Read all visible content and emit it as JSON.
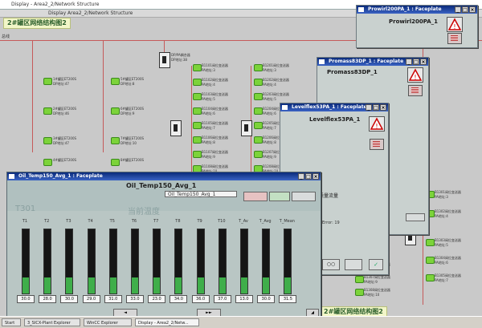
{
  "main_window": {
    "title": "Display - Area2_2/Network Structure",
    "menu": "Display Area2_2/Network Structure",
    "page_banner": "2#罐区网络结构图2",
    "left_label": "总线"
  },
  "network": {
    "left_column": [
      {
        "name": "1#罐区ET200S",
        "sub": "DP地址:47"
      },
      {
        "name": "2#罐区ET200S",
        "sub": "DP地址:46"
      },
      {
        "name": "3#罐区ET200S",
        "sub": "DP地址:47"
      },
      {
        "name": "4#罐区ET200S",
        "sub": "DP地址:49"
      }
    ],
    "mid_column": [
      {
        "name": "5#罐区ET200S",
        "sub": "DP地址:8"
      },
      {
        "name": "6#罐区ET200S",
        "sub": "DP地址:9"
      },
      {
        "name": "7#罐区ET200S",
        "sub": "DP地址:10"
      },
      {
        "name": "8#罐区ET200S",
        "sub": "DP地址:11"
      }
    ],
    "link_label": "DP/PA耦合器",
    "link_sub": "DP地址:38",
    "col3": [
      {
        "name": "B1101阀位变送器",
        "sub": "PA地址:3"
      },
      {
        "name": "B1102阀位变送器",
        "sub": "PA地址:4"
      },
      {
        "name": "B1103阀位变送器",
        "sub": "PA地址:5"
      },
      {
        "name": "B1104阀位变送器",
        "sub": "PA地址:6"
      },
      {
        "name": "B1105阀位变送器",
        "sub": "PA地址:7"
      },
      {
        "name": "B1106阀位变送器",
        "sub": "PA地址:8"
      },
      {
        "name": "B1107阀位变送器",
        "sub": "PA地址:9"
      },
      {
        "name": "B1108阀位变送器",
        "sub": "PA地址:10"
      }
    ],
    "col4": [
      {
        "name": "B1201阀位变送器",
        "sub": "PA地址:3"
      },
      {
        "name": "B1202阀位变送器",
        "sub": "PA地址:4"
      },
      {
        "name": "B1203阀位变送器",
        "sub": "PA地址:5"
      },
      {
        "name": "B1204阀位变送器",
        "sub": "PA地址:6"
      },
      {
        "name": "B1205阀位变送器",
        "sub": "PA地址:7"
      },
      {
        "name": "B1206阀位变送器",
        "sub": "PA地址:8"
      },
      {
        "name": "B1207阀位变送器",
        "sub": "PA地址:9"
      },
      {
        "name": "B1208阀位变送器",
        "sub": "PA地址:10"
      }
    ],
    "right_column": [
      {
        "name": "B1301阀位变送器",
        "sub": "PA地址:3"
      },
      {
        "name": "B1302阀位变送器",
        "sub": "PA地址:4"
      },
      {
        "name": "B1303阀位变送器",
        "sub": "PA地址:5"
      },
      {
        "name": "B1304阀位变送器",
        "sub": "PA地址:6"
      },
      {
        "name": "B1305阀位变送器",
        "sub": "PA地址:7"
      }
    ],
    "bottom_banner": "2#罐区网络结构图2",
    "bottom_nodes": [
      {
        "name": "B1306阀位变送器",
        "sub": "PA地址:8"
      },
      {
        "name": "B1307阀位变送器",
        "sub": "PA地址:9"
      },
      {
        "name": "B1308阀位变送器",
        "sub": "PA地址:10"
      }
    ]
  },
  "faceplates": {
    "prowirl": {
      "title": "Prowirl200PA_1 : Faceplate",
      "name": "Prowirl200PA_1"
    },
    "promass": {
      "title": "Promass83DP_1 : Faceplate",
      "name": "Promass83DP_1"
    },
    "levelflex": {
      "title": "Levelflex53PA_1 : Faceplate",
      "name": "Levelflex53PA_1",
      "partial_text": "质量流量",
      "partial_text2": "Error: 19",
      "partial_text3": "质量流量"
    }
  },
  "oil": {
    "title": "Oil_Temp150_Avg_1 : Faceplate",
    "name": "Oil_Temp150_Avg_1",
    "field": "Oil_Temp150_Avg_1",
    "tag": "T301",
    "heading": "当前温度",
    "channels": [
      {
        "label": "T1",
        "value": "30.0",
        "level": 0.25
      },
      {
        "label": "T2",
        "value": "28.0",
        "level": 0.25
      },
      {
        "label": "T3",
        "value": "30.0",
        "level": 0.25
      },
      {
        "label": "T4",
        "value": "29.0",
        "level": 0.25
      },
      {
        "label": "T5",
        "value": "31.0",
        "level": 0.25
      },
      {
        "label": "T6",
        "value": "33.0",
        "level": 0.25
      },
      {
        "label": "T7",
        "value": "23.0",
        "level": 0.25
      },
      {
        "label": "T8",
        "value": "34.0",
        "level": 0.25
      },
      {
        "label": "T9",
        "value": "36.0",
        "level": 0.25
      },
      {
        "label": "T10",
        "value": "37.0",
        "level": 0.25
      },
      {
        "label": "T_Av",
        "value": "13.0",
        "level": 0.25
      },
      {
        "label": "T_Avg",
        "value": "30.0",
        "level": 0.25
      },
      {
        "label": "T_Mean",
        "value": "31.5",
        "level": 0.25
      }
    ]
  },
  "taskbar": {
    "items": [
      "Start",
      "3_SICX-Plant Explorer",
      "WinCC Explorer",
      "Display - Area2_2/Netw..."
    ]
  },
  "colors": {
    "title_bar": "#0a2a7a",
    "node_green": "#7cd33a",
    "wire_red": "#c55a5a",
    "bar_fill": "#3fae4a"
  }
}
